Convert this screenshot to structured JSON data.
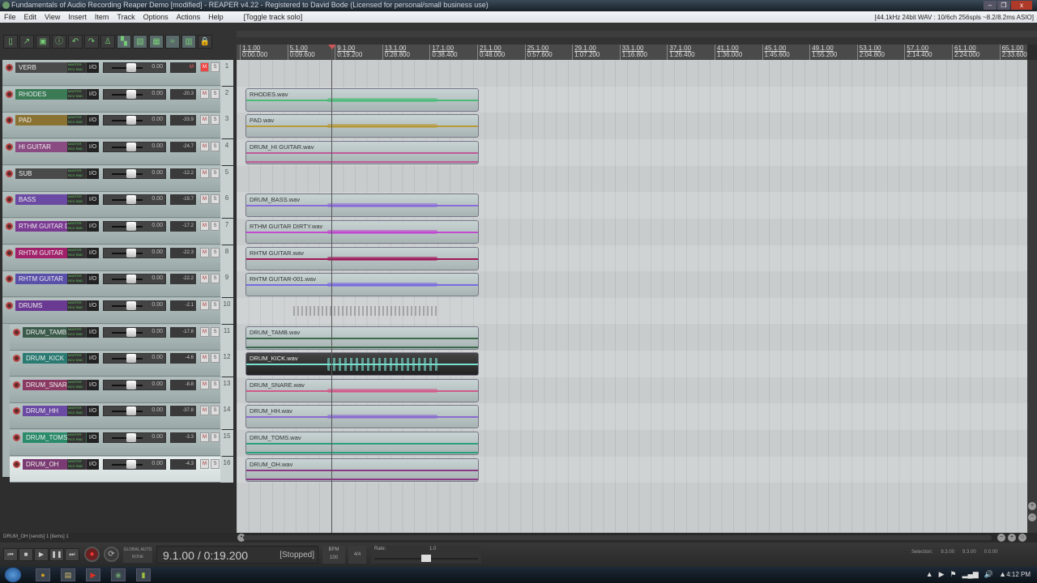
{
  "window": {
    "title": "Fundamentals of Audio Recording Reaper Demo [modified] - REAPER v4.22 - Registered to David Bode (Licensed for personal/small business use)",
    "min": "–",
    "max": "❐",
    "close": "x"
  },
  "menu": {
    "items": [
      "File",
      "Edit",
      "View",
      "Insert",
      "Item",
      "Track",
      "Options",
      "Actions",
      "Help"
    ],
    "last_action": "[Toggle track solo]",
    "audio_status": "[44.1kHz 24bit WAV : 10/6ch 256spls ~8.2/8.2ms ASIO]"
  },
  "toolbar": {
    "icons": [
      "new-project",
      "open-project",
      "save-project",
      "project-settings",
      "undo",
      "redo",
      "metronome",
      "auto-crossfade",
      "ripple-edit",
      "item-grouping",
      "snap",
      "grid",
      "lock"
    ],
    "glyphs": [
      "▯",
      "↗",
      "▣",
      "ⓘ",
      "↶",
      "↷",
      "♙",
      "▚",
      "▧",
      "▦",
      "≈",
      "▥",
      "🔒"
    ]
  },
  "ruler": [
    [
      "1.1.00",
      "0:00.000"
    ],
    [
      "5.1.00",
      "0:09.600"
    ],
    [
      "9.1.00",
      "0:19.200"
    ],
    [
      "13.1.00",
      "0:28.800"
    ],
    [
      "17.1.00",
      "0:38.400"
    ],
    [
      "21.1.00",
      "0:48.000"
    ],
    [
      "25.1.00",
      "0:57.600"
    ],
    [
      "29.1.00",
      "1:07.200"
    ],
    [
      "33.1.00",
      "1:16.800"
    ],
    [
      "37.1.00",
      "1:26.400"
    ],
    [
      "41.1.00",
      "1:36.000"
    ],
    [
      "45.1.00",
      "1:45.600"
    ],
    [
      "49.1.00",
      "1:55.200"
    ],
    [
      "53.1.00",
      "2:04.800"
    ],
    [
      "57.1.00",
      "2:14.400"
    ],
    [
      "61.1.00",
      "2:24.000"
    ],
    [
      "65.1.00",
      "2:33.600"
    ]
  ],
  "tracks": [
    {
      "num": "1",
      "name": "VERB",
      "color": "#4a4a4a",
      "vol": "0.00",
      "meter": "M",
      "muted": true,
      "item": null
    },
    {
      "num": "2",
      "name": "RHODES",
      "color": "#3a7a55",
      "vol": "0.00",
      "meter": "-20.3",
      "item": "RHODES.wav",
      "wave": "#4cba78"
    },
    {
      "num": "3",
      "name": "PAD",
      "color": "#8a7232",
      "vol": "0.00",
      "meter": "-33.9",
      "item": "PAD.wav",
      "wave": "#b89a3a"
    },
    {
      "num": "4",
      "name": "HI GUITAR",
      "color": "#8a4a82",
      "vol": "0.00",
      "meter": "-24.7",
      "item": "DRUM_HI GUITAR.wav",
      "wave": "#c05a9a",
      "stereo": true
    },
    {
      "num": "5",
      "name": "SUB",
      "color": "#4a4a4a",
      "vol": "0.00",
      "meter": "-12.2",
      "item": null
    },
    {
      "num": "6",
      "name": "BASS",
      "color": "#6a4aa2",
      "vol": "0.00",
      "meter": "-19.7",
      "item": "DRUM_BASS.wav",
      "wave": "#8a6ad8"
    },
    {
      "num": "7",
      "name": "RTHM GUITAR D",
      "color": "#7a3a92",
      "vol": "0.00",
      "meter": "-17.2",
      "item": "RTHM GUITAR DIRTY.wav",
      "wave": "#c04ad0"
    },
    {
      "num": "8",
      "name": "RHTM GUITAR",
      "color": "#a0206a",
      "vol": "0.00",
      "meter": "-22.3",
      "item": "RHTM GUITAR.wav",
      "wave": "#a01858"
    },
    {
      "num": "9",
      "name": "RHTM GUITAR",
      "color": "#5a50aa",
      "vol": "0.00",
      "meter": "-22.2",
      "item": "RHTM GUITAR-001.wav",
      "wave": "#7a6ae0"
    },
    {
      "num": "10",
      "name": "DRUMS",
      "color": "#6a3a92",
      "vol": "0.00",
      "meter": "-2.1",
      "item": null,
      "folder": true
    },
    {
      "num": "11",
      "name": "DRUM_TAMB",
      "color": "#3a5a4a",
      "vol": "0.00",
      "meter": "-17.8",
      "item": "DRUM_TAMB.wav",
      "wave": "#3a6a4a",
      "stereo": true,
      "child": true
    },
    {
      "num": "12",
      "name": "DRUM_KICK",
      "color": "#2a7a72",
      "vol": "0.00",
      "meter": "-4.6",
      "item": "DRUM_KICK.wav",
      "wave": "#7ae0d0",
      "dark": true,
      "child": true
    },
    {
      "num": "13",
      "name": "DRUM_SNARE",
      "color": "#8a3a62",
      "vol": "0.00",
      "meter": "-8.8",
      "item": "DRUM_SNARE.wav",
      "wave": "#d05a8a",
      "child": true
    },
    {
      "num": "14",
      "name": "DRUM_HH",
      "color": "#6a4aa2",
      "vol": "0.00",
      "meter": "-37.8",
      "item": "DRUM_HH.wav",
      "wave": "#8a6ad0",
      "child": true
    },
    {
      "num": "15",
      "name": "DRUM_TOMS",
      "color": "#2a8a6a",
      "vol": "0.00",
      "meter": "-3.3",
      "item": "DRUM_TOMS.wav",
      "wave": "#2aa07a",
      "stereo": true,
      "child": true
    },
    {
      "num": "16",
      "name": "DRUM_OH",
      "color": "#7a3a72",
      "vol": "0.00",
      "meter": "-4.3",
      "item": "DRUM_OH.wav",
      "wave": "#8a3a82",
      "stereo": true,
      "child": true,
      "selected": true
    }
  ],
  "track_labels": {
    "io": "I/O",
    "mute": "M",
    "solo": "S",
    "route": "MASTER RCV SND"
  },
  "statusline": "DRUM_OH [sends] 1 [items] 1",
  "transport": {
    "position": "9.1.00 / 0:19.200",
    "state": "[Stopped]",
    "bpm_label": "BPM",
    "bpm": "100",
    "timesig": "4/4",
    "rate_label": "Rate:",
    "rate": "1.0",
    "rate_value": 0.5,
    "global_auto": "GLOBAL AUTO",
    "global_auto_mode": "NONE",
    "buttons": [
      [
        "go-to-start",
        "⏮"
      ],
      [
        "stop",
        "■"
      ],
      [
        "play",
        "▶"
      ],
      [
        "pause",
        "❚❚"
      ],
      [
        "go-to-end",
        "⏭"
      ]
    ],
    "record": "●",
    "repeat": "⟳"
  },
  "selection": {
    "label": "Selection:",
    "start": "9.3.00",
    "end": "9.3.00",
    "length": "0.0.00"
  },
  "taskbar": {
    "apps": [
      [
        "chrome",
        "●",
        "#d8a020"
      ],
      [
        "explorer",
        "▤",
        "#d8c070"
      ],
      [
        "media",
        "▶",
        "#e03020"
      ],
      [
        "reaper",
        "◉",
        "#6a9a6a"
      ],
      [
        "other",
        "▮",
        "#a0c040"
      ]
    ],
    "tray": [
      "▲",
      "▶",
      "⚑",
      "▂▄▆",
      "🔊",
      "▲"
    ],
    "clock": "4:12 PM"
  }
}
